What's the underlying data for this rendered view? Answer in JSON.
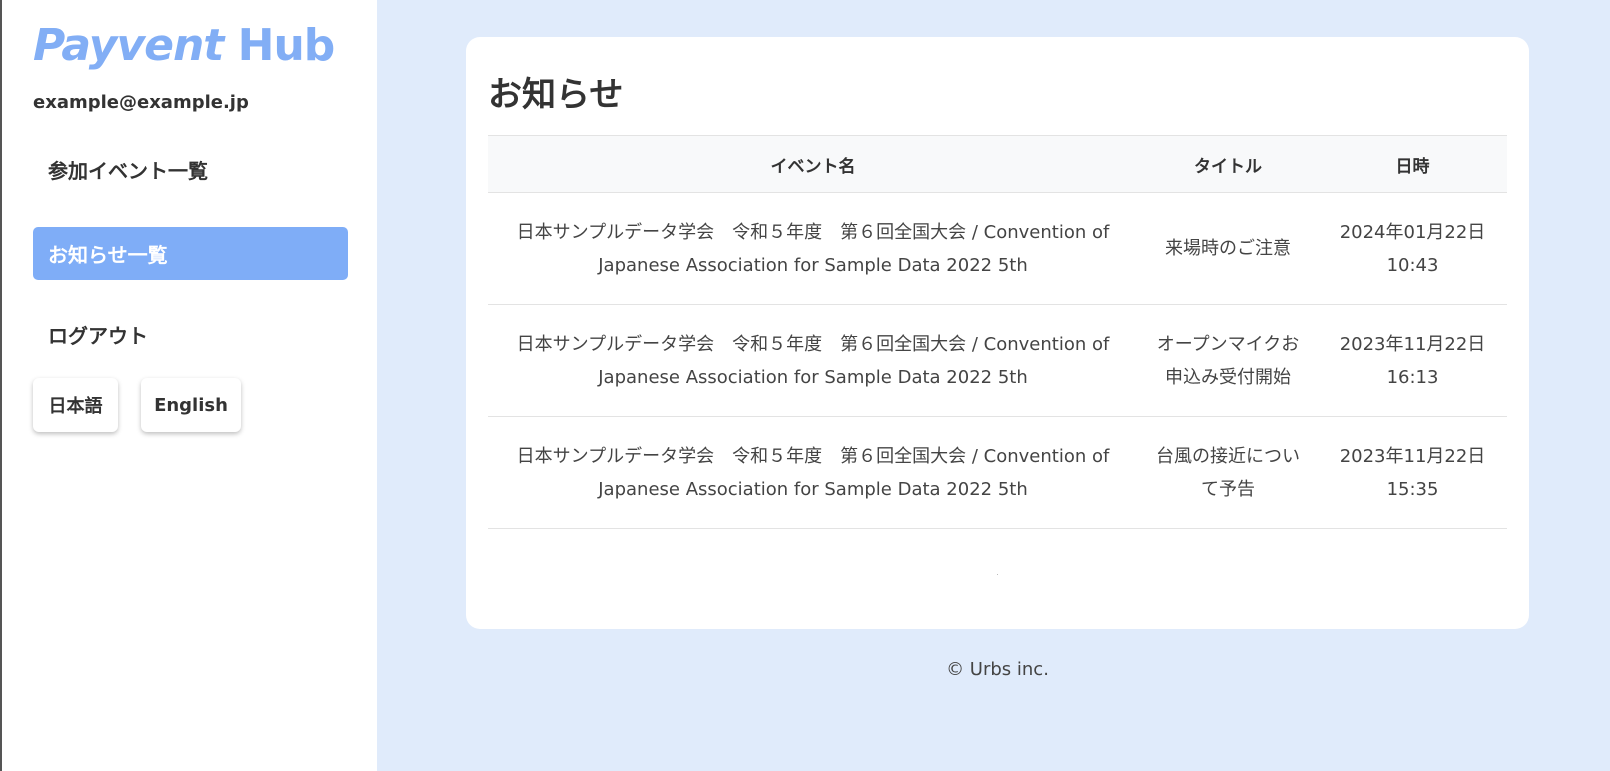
{
  "app": {
    "logo_part1": "Payvent",
    "logo_part2": " Hub",
    "user_email": "example@example.jp"
  },
  "sidebar": {
    "items": [
      {
        "label": "参加イベント一覧",
        "active": false
      },
      {
        "label": "お知らせ一覧",
        "active": true
      },
      {
        "label": "ログアウト",
        "active": false
      }
    ],
    "languages": [
      "日本語",
      "English"
    ]
  },
  "main": {
    "title": "お知らせ",
    "columns": [
      "イベント名",
      "タイトル",
      "日時"
    ],
    "rows": [
      {
        "event": "日本サンプルデータ学会　令和５年度　第６回全国大会 / Convention of Japanese Association for Sample Data 2022 5th",
        "title": "来場時のご注意",
        "date": "2024年01月22日 10:43"
      },
      {
        "event": "日本サンプルデータ学会　令和５年度　第６回全国大会 / Convention of Japanese Association for Sample Data 2022 5th",
        "title": "オープンマイクお申込み受付開始",
        "date": "2023年11月22日 16:13"
      },
      {
        "event": "日本サンプルデータ学会　令和５年度　第６回全国大会 / Convention of Japanese Association for Sample Data 2022 5th",
        "title": "台風の接近について予告",
        "date": "2023年11月22日 15:35"
      }
    ]
  },
  "footer": {
    "copyright": "© Urbs inc."
  },
  "colors": {
    "accent": "#7fadf7",
    "logo": "#82aef5",
    "background": "#e0ebfb"
  }
}
